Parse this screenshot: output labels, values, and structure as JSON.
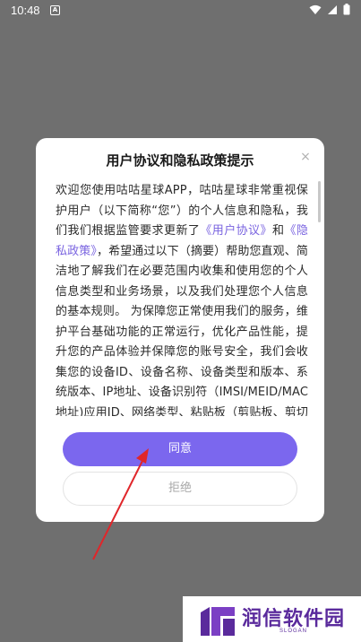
{
  "status_bar": {
    "time": "10:48",
    "notif_glyph": "A",
    "icons": [
      "wifi-icon",
      "signal-icon",
      "battery-icon"
    ]
  },
  "dialog": {
    "title": "用户协议和隐私政策提示",
    "close_glyph": "×",
    "body": {
      "intro": "欢迎您使用咕咕星球APP，咕咕星球非常重视保护用户（以下简称“您”）的个人信息和隐私，我们我们根据监管要求更新了",
      "link_user_agreement": "《用户协议》",
      "and": "和",
      "link_privacy_policy": "《隐私政策》",
      "rest": "，希望通过以下（摘要）帮助您直观、简洁地了解我们在必要范围内收集和使用您的个人信息类型和业务场景，以及我们处理您个人信息的基本规则。 为保障您正常使用我们的服务，维护平台基础功能的正常运行，优化产品性能，提升您的产品体验并保障您的账号安全，我们会收集您的设备ID、设备名称、设备类型和版本、系统版本、IP地址、设备识别符（IMSI/MEID/MAC地址)应用ID、网络类型、粘贴板（剪贴板、剪切板）、SIM卡、"
    },
    "agree_label": "同意",
    "reject_label": "拒绝"
  },
  "watermark": {
    "brand": "润信软件园",
    "slogan": "SLOGAN"
  },
  "colors": {
    "accent": "#7b67ee",
    "link": "#7a64e0",
    "overlay": "#6f6f6f",
    "arrow": "#e0262a",
    "brand": "#5a2a9c"
  }
}
